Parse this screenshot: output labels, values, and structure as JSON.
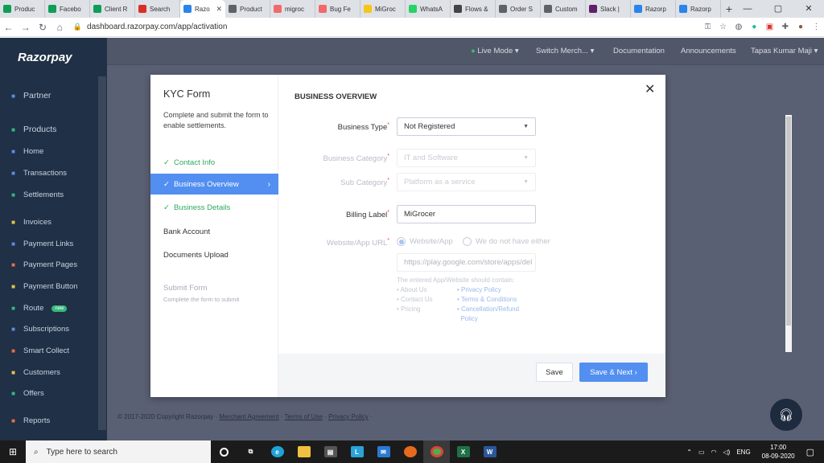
{
  "browser": {
    "tabs": [
      {
        "label": "Produc",
        "icon": "sheets-icon",
        "color": "#0f9d58"
      },
      {
        "label": "Facebo",
        "icon": "sheets-icon",
        "color": "#0f9d58"
      },
      {
        "label": "Client R",
        "icon": "sheets-icon",
        "color": "#0f9d58"
      },
      {
        "label": "Search",
        "icon": "gmail-icon",
        "color": "#d93025"
      },
      {
        "label": "Razo",
        "icon": "razorpay-icon",
        "color": "#2b84ea",
        "active": true
      },
      {
        "label": "Product",
        "icon": "globe-icon",
        "color": "#5f6368"
      },
      {
        "label": "migroc",
        "icon": "asana-icon",
        "color": "#f06a6a"
      },
      {
        "label": "Bug Fe",
        "icon": "asana-icon",
        "color": "#f06a6a"
      },
      {
        "label": "MiGroc",
        "icon": "app-icon",
        "color": "#f5c518"
      },
      {
        "label": "WhatsA",
        "icon": "whatsapp-icon",
        "color": "#25d366"
      },
      {
        "label": "Flows &",
        "icon": "mail-icon",
        "color": "#444444"
      },
      {
        "label": "Order S",
        "icon": "globe-icon",
        "color": "#5f6368"
      },
      {
        "label": "Custom",
        "icon": "app-icon",
        "color": "#5f6368"
      },
      {
        "label": "Slack |",
        "icon": "slack-icon",
        "color": "#611f69"
      },
      {
        "label": "Razorp",
        "icon": "razorpay-icon",
        "color": "#2b84ea"
      },
      {
        "label": "Razorp",
        "icon": "razorpay-icon",
        "color": "#2b84ea"
      }
    ],
    "url": "dashboard.razorpay.com/app/activation"
  },
  "app": {
    "logo": "Razorpay",
    "sidebar": {
      "partner": "Partner",
      "products": "Products",
      "items": [
        "Home",
        "Transactions",
        "Settlements",
        "Invoices",
        "Payment Links",
        "Payment Pages",
        "Payment Button",
        "Route",
        "Subscriptions",
        "Smart Collect",
        "Customers",
        "Offers",
        "Reports"
      ],
      "new_badge": "new"
    },
    "topnav": {
      "live_mode": "Live Mode",
      "switch_merchant": "Switch Merch...",
      "documentation": "Documentation",
      "announcements": "Announcements",
      "user": "Tapas Kumar Maji"
    },
    "footer": {
      "copyright": "© 2017-2020 Copyright Razorpay ·",
      "merchant_agreement": "Merchant Agreement",
      "terms": "Terms of Use",
      "privacy": "Privacy Policy",
      "sep": "·"
    }
  },
  "modal": {
    "title": "KYC Form",
    "subtitle": "Complete and submit the form to enable settlements.",
    "steps": [
      {
        "label": "Contact Info",
        "state": "done"
      },
      {
        "label": "Business Overview",
        "state": "active"
      },
      {
        "label": "Business Details",
        "state": "done"
      },
      {
        "label": "Bank Account",
        "state": "plain"
      },
      {
        "label": "Documents Upload",
        "state": "plain"
      }
    ],
    "submit_title": "Submit Form",
    "submit_sub": "Complete the form to submit",
    "section_title": "BUSINESS OVERVIEW",
    "fields": {
      "business_type": {
        "label": "Business Type",
        "value": "Not Registered"
      },
      "business_category": {
        "label": "Business Category",
        "value": "IT and Software"
      },
      "sub_category": {
        "label": "Sub Category",
        "value": "Platform as a service"
      },
      "billing_label": {
        "label": "Billing Label",
        "value": "MiGrocer"
      },
      "website": {
        "label": "Website/App URL",
        "option1": "Website/App",
        "option2": "We do not have either",
        "placeholder": "https://play.google.com/store/apps/del"
      }
    },
    "hint": {
      "intro": "The entered App/Website should contain:",
      "left": [
        "About Us",
        "Contact Us",
        "Pricing"
      ],
      "right": [
        "Privacy Policy",
        "Terms & Conditions",
        "Cancellation/Refund",
        "Policy"
      ]
    },
    "buttons": {
      "save": "Save",
      "save_next": "Save & Next"
    }
  },
  "taskbar": {
    "search_placeholder": "Type here to search",
    "lang": "ENG",
    "time": "17:00",
    "date": "08-09-2020"
  }
}
